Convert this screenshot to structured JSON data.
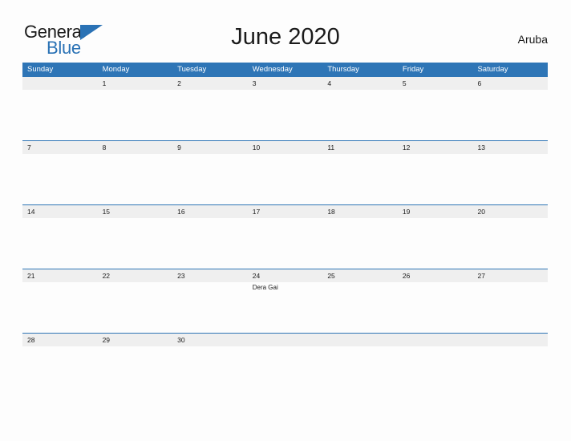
{
  "brand": {
    "line1": "General",
    "line2": "Blue",
    "accent_color": "#2a72b5",
    "triangle_icon": "triangle-icon"
  },
  "header": {
    "title": "June 2020",
    "region": "Aruba"
  },
  "calendar": {
    "header_bg": "#2e75b6",
    "number_band_bg": "#efefef",
    "separator_color": "#2e75b6",
    "day_names": [
      "Sunday",
      "Monday",
      "Tuesday",
      "Wednesday",
      "Thursday",
      "Friday",
      "Saturday"
    ],
    "weeks": [
      {
        "days": [
          {
            "date": "",
            "events": []
          },
          {
            "date": "1",
            "events": []
          },
          {
            "date": "2",
            "events": []
          },
          {
            "date": "3",
            "events": []
          },
          {
            "date": "4",
            "events": []
          },
          {
            "date": "5",
            "events": []
          },
          {
            "date": "6",
            "events": []
          }
        ]
      },
      {
        "days": [
          {
            "date": "7",
            "events": []
          },
          {
            "date": "8",
            "events": []
          },
          {
            "date": "9",
            "events": []
          },
          {
            "date": "10",
            "events": []
          },
          {
            "date": "11",
            "events": []
          },
          {
            "date": "12",
            "events": []
          },
          {
            "date": "13",
            "events": []
          }
        ]
      },
      {
        "days": [
          {
            "date": "14",
            "events": []
          },
          {
            "date": "15",
            "events": []
          },
          {
            "date": "16",
            "events": []
          },
          {
            "date": "17",
            "events": []
          },
          {
            "date": "18",
            "events": []
          },
          {
            "date": "19",
            "events": []
          },
          {
            "date": "20",
            "events": []
          }
        ]
      },
      {
        "days": [
          {
            "date": "21",
            "events": []
          },
          {
            "date": "22",
            "events": []
          },
          {
            "date": "23",
            "events": []
          },
          {
            "date": "24",
            "events": [
              "Dera Gai"
            ]
          },
          {
            "date": "25",
            "events": []
          },
          {
            "date": "26",
            "events": []
          },
          {
            "date": "27",
            "events": []
          }
        ]
      },
      {
        "days": [
          {
            "date": "28",
            "events": []
          },
          {
            "date": "29",
            "events": []
          },
          {
            "date": "30",
            "events": []
          },
          {
            "date": "",
            "events": []
          },
          {
            "date": "",
            "events": []
          },
          {
            "date": "",
            "events": []
          },
          {
            "date": "",
            "events": []
          }
        ]
      }
    ]
  }
}
